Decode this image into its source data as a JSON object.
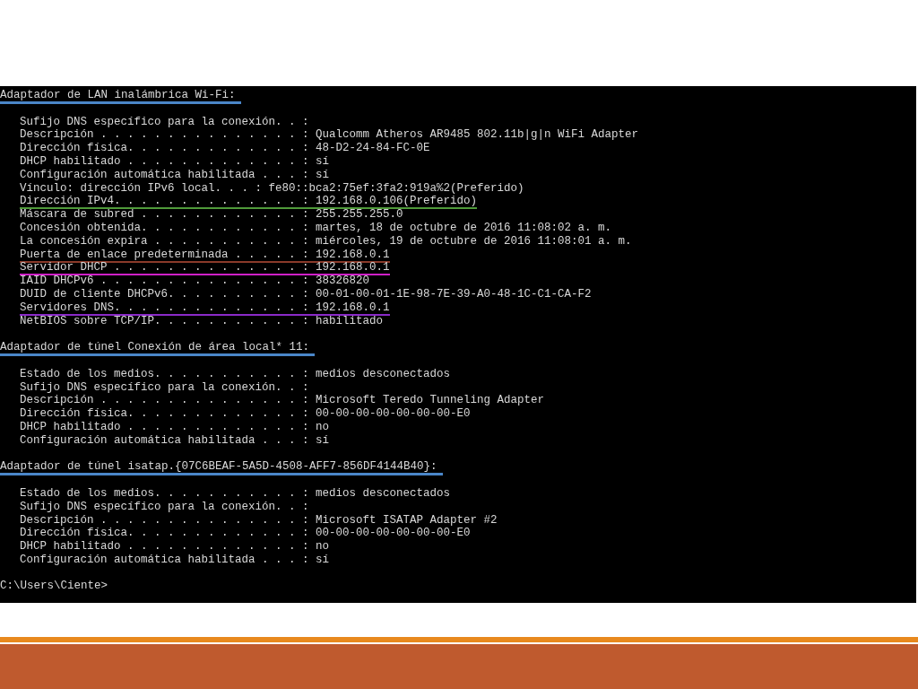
{
  "console": {
    "sections": [
      {
        "header": "Adaptador de LAN inalámbrica Wi-Fi:",
        "color": "#4a86c8",
        "lines": [
          {
            "text": "Sufijo DNS específico para la conexión. . :"
          },
          {
            "text": "Descripción . . . . . . . . . . . . . . . : Qualcomm Atheros AR9485 802.11b|g|n WiFi Adapter"
          },
          {
            "text": "Dirección física. . . . . . . . . . . . . : 48-D2-24-84-FC-0E"
          },
          {
            "text": "DHCP habilitado . . . . . . . . . . . . . : sí"
          },
          {
            "text": "Configuración automática habilitada . . . : sí"
          },
          {
            "text": "Vínculo: dirección IPv6 local. . . : fe80::bca2:75ef:3fa2:919a%2(Preferido)"
          },
          {
            "text": "Dirección IPv4. . . . . . . . . . . . . . : 192.168.0.106(Preferido)",
            "color": "#4f9a3a"
          },
          {
            "text": "Máscara de subred . . . . . . . . . . . . : 255.255.255.0"
          },
          {
            "text": "Concesión obtenida. . . . . . . . . . . . : martes, 18 de octubre de 2016 11:08:02 a. m."
          },
          {
            "text": "La concesión expira . . . . . . . . . . . : miércoles, 19 de octubre de 2016 11:08:01 a. m."
          },
          {
            "text": "Puerta de enlace predeterminada . . . . . : 192.168.0.1",
            "color": "#8a3a2a"
          },
          {
            "text": "Servidor DHCP . . . . . . . . . . . . . . : 192.168.0.1",
            "color": "#d020c8"
          },
          {
            "text": "IAID DHCPv6 . . . . . . . . . . . . . . . : 38326820"
          },
          {
            "text": "DUID de cliente DHCPv6. . . . . . . . . . : 00-01-00-01-1E-98-7E-39-A0-48-1C-C1-CA-F2"
          },
          {
            "text": "Servidores DNS. . . . . . . . . . . . . . : 192.168.0.1",
            "color": "#8a2ac8"
          },
          {
            "text": "NetBIOS sobre TCP/IP. . . . . . . . . . . : habilitado"
          }
        ]
      },
      {
        "header": "Adaptador de túnel Conexión de área local* 11:",
        "color": "#4a86c8",
        "lines": [
          {
            "text": "Estado de los medios. . . . . . . . . . . : medios desconectados"
          },
          {
            "text": "Sufijo DNS específico para la conexión. . :"
          },
          {
            "text": "Descripción . . . . . . . . . . . . . . . : Microsoft Teredo Tunneling Adapter"
          },
          {
            "text": "Dirección física. . . . . . . . . . . . . : 00-00-00-00-00-00-00-E0"
          },
          {
            "text": "DHCP habilitado . . . . . . . . . . . . . : no"
          },
          {
            "text": "Configuración automática habilitada . . . : sí"
          }
        ]
      },
      {
        "header": "Adaptador de túnel isatap.{07C6BEAF-5A5D-4508-AFF7-856DF4144B40}:",
        "color": "#4a86c8",
        "lines": [
          {
            "text": "Estado de los medios. . . . . . . . . . . : medios desconectados"
          },
          {
            "text": "Sufijo DNS específico para la conexión. . :"
          },
          {
            "text": "Descripción . . . . . . . . . . . . . . . : Microsoft ISATAP Adapter #2"
          },
          {
            "text": "Dirección física. . . . . . . . . . . . . : 00-00-00-00-00-00-00-E0"
          },
          {
            "text": "DHCP habilitado . . . . . . . . . . . . . : no"
          },
          {
            "text": "Configuración automática habilitada . . . : sí"
          }
        ]
      }
    ],
    "prompt": "C:\\Users\\Ciente>"
  }
}
